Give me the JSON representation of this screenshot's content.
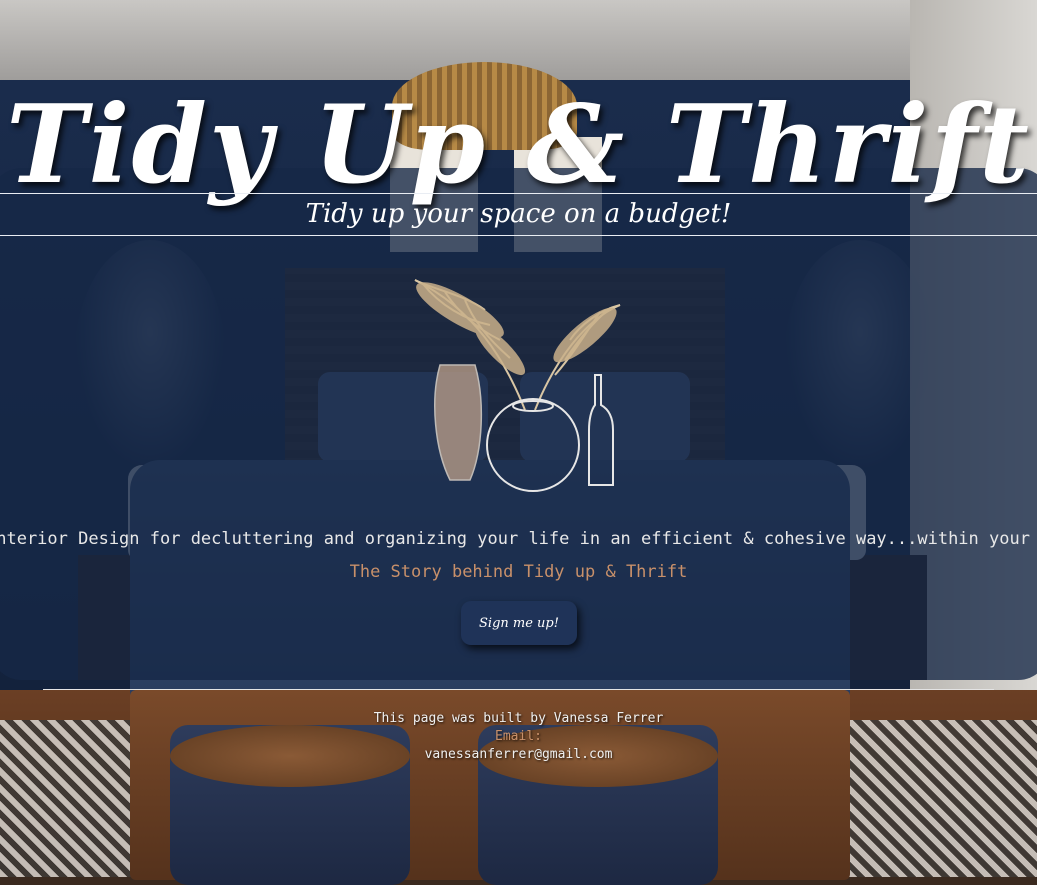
{
  "header": {
    "site_title": "Tidy Up & Thrift",
    "tagline": "Tidy up your space on a budget!"
  },
  "main": {
    "mission": "Interior Design for decluttering and organizing your life in an efficient & cohesive way...within your budget.",
    "story_link": "The Story behind Tidy up & Thrift",
    "signup_label": "Sign me up!"
  },
  "footer": {
    "built_by": "This page was built by Vanessa Ferrer",
    "email_label": "Email:",
    "email": "vanessanferrer@gmail.com"
  },
  "colors": {
    "panel": "#16284a",
    "link_accent": "#c8906a",
    "button": "#1f3358"
  },
  "icons": {
    "logo": "pampas-grass-vases-logo"
  }
}
